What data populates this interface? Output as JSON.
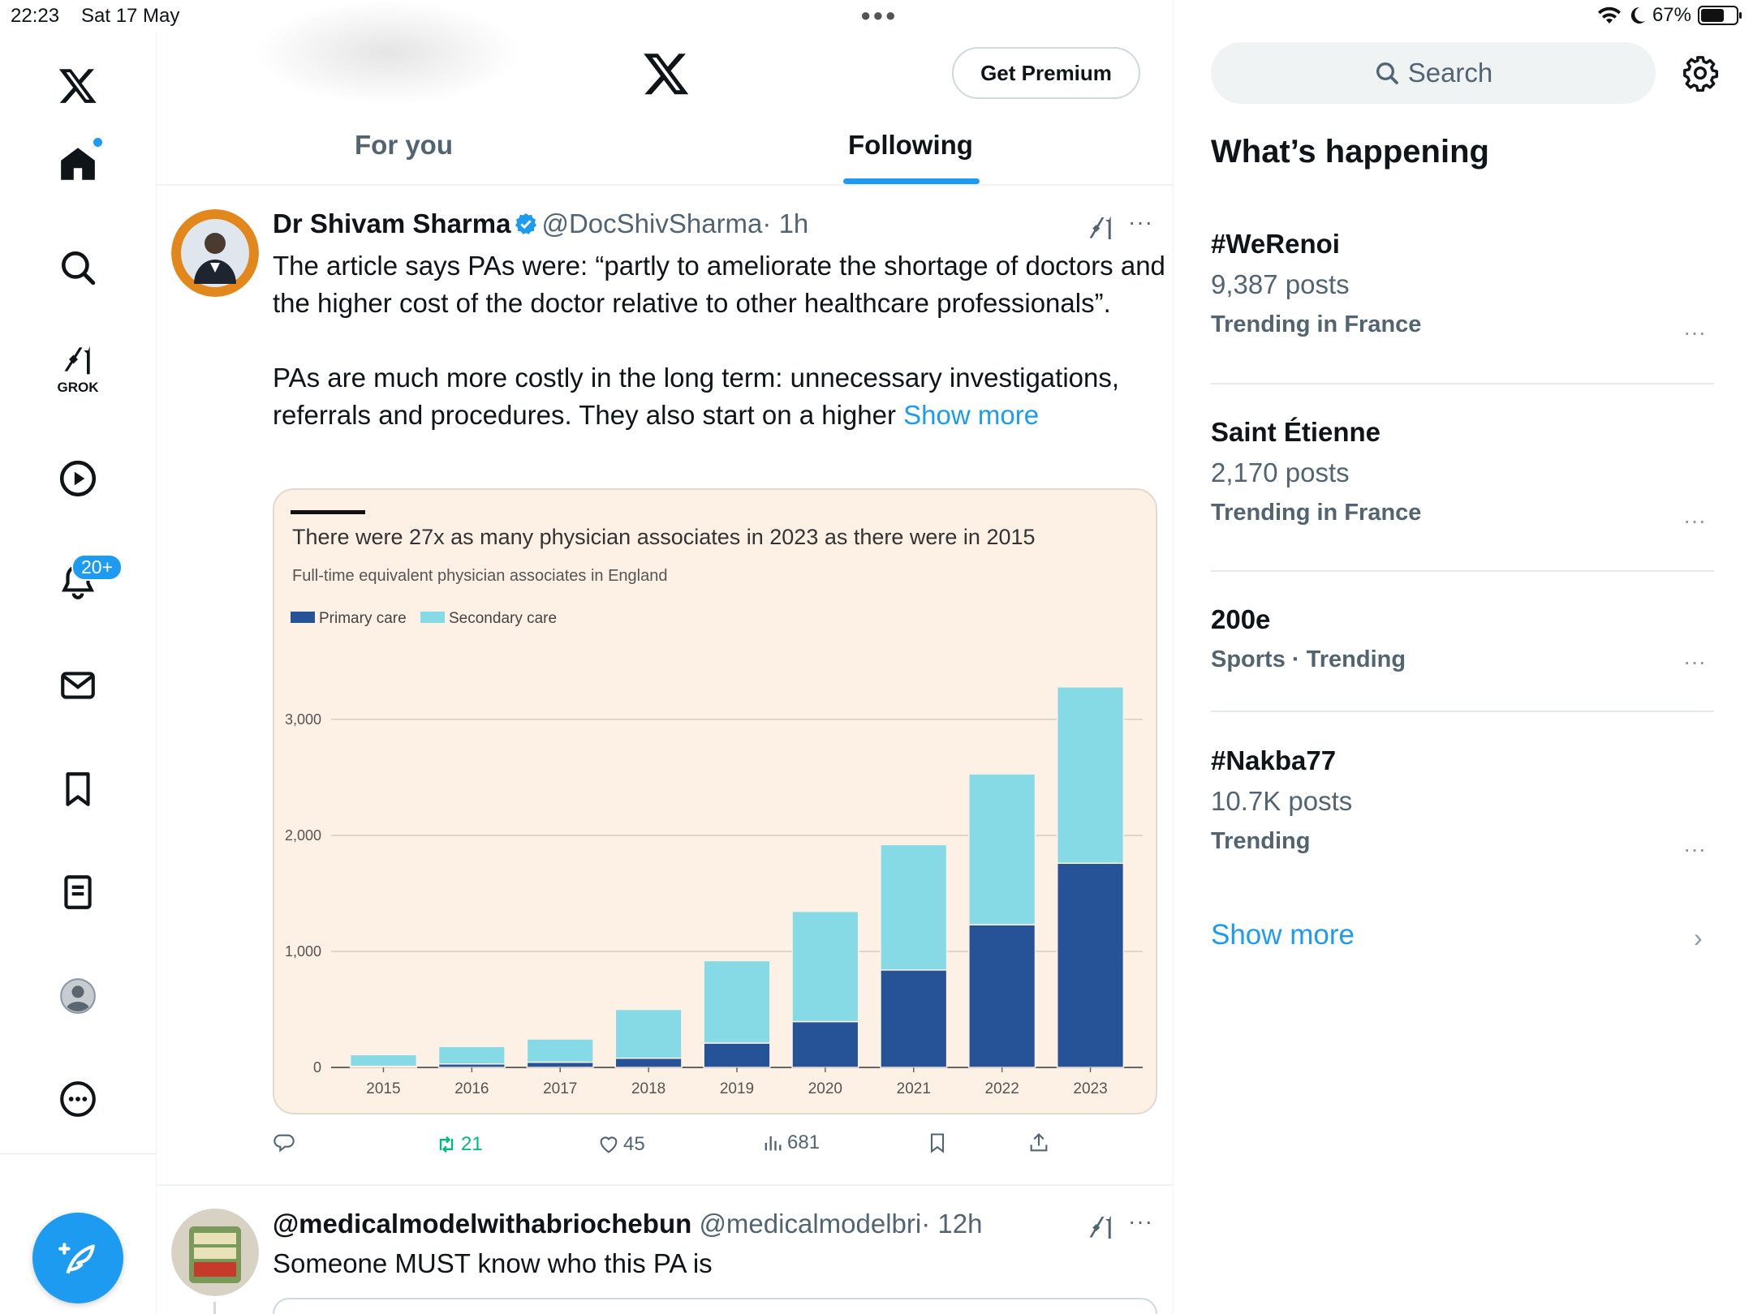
{
  "status_bar": {
    "time": "22:23",
    "date": "Sat 17 May",
    "battery": "67%",
    "battery_level": 0.67
  },
  "nav": {
    "grok_label": "GROK",
    "notifications_badge": "20+"
  },
  "header": {
    "premium_label": "Get Premium",
    "tabs": [
      {
        "label": "For you",
        "active": false
      },
      {
        "label": "Following",
        "active": true
      }
    ]
  },
  "tweets": [
    {
      "name": "Dr Shivam Sharma",
      "handle": "@DocShivSharma",
      "time": "· 1h",
      "text_p1": "The article says PAs were: “partly to ameliorate the shortage of doctors and the higher cost of the doctor relative to other healthcare professionals”.",
      "text_p2": "PAs are much more costly in the long term: unnecessary investigations, referrals and procedures. They also start on a higher",
      "show_more": "Show more",
      "counts": {
        "replies": "",
        "retweets": "21",
        "likes": "45",
        "views": "681"
      }
    },
    {
      "name": "@medicalmodelwithabriochebun",
      "handle": "@medicalmodelbri",
      "time": "· 12h",
      "text": "Someone MUST know who this PA is"
    }
  ],
  "chart_data": {
    "type": "bar",
    "stacked": true,
    "title": "There were 27x as many physician associates in 2023 as there were in 2015",
    "subtitle": "Full-time equivalent physician associates in England",
    "categories": [
      "2015",
      "2016",
      "2017",
      "2018",
      "2019",
      "2020",
      "2021",
      "2022",
      "2023"
    ],
    "series": [
      {
        "name": "Primary care",
        "color": "#265398",
        "values": [
          10,
          30,
          45,
          80,
          210,
          395,
          840,
          1230,
          1760
        ]
      },
      {
        "name": "Secondary care",
        "color": "#86dae6",
        "values": [
          100,
          150,
          200,
          420,
          710,
          950,
          1080,
          1300,
          1520
        ]
      }
    ],
    "yticks": [
      0,
      1000,
      2000,
      3000
    ],
    "ytick_labels": [
      "0",
      "1,000",
      "2,000",
      "3,000"
    ],
    "ylim": [
      0,
      3300
    ],
    "grid": true,
    "legend": "top-left"
  },
  "sidebar": {
    "search_placeholder": "Search",
    "title": "What’s happening",
    "trends": [
      {
        "topic": "#WeRenoi",
        "posts": "9,387 posts",
        "context": "Trending in France"
      },
      {
        "topic": "Saint Étienne",
        "posts": "2,170 posts",
        "context": "Trending in France"
      },
      {
        "topic": "200e",
        "posts": "",
        "context": "Sports · Trending"
      },
      {
        "topic": "#Nakba77",
        "posts": "10.7K posts",
        "context": "Trending"
      }
    ],
    "show_more": "Show more"
  }
}
